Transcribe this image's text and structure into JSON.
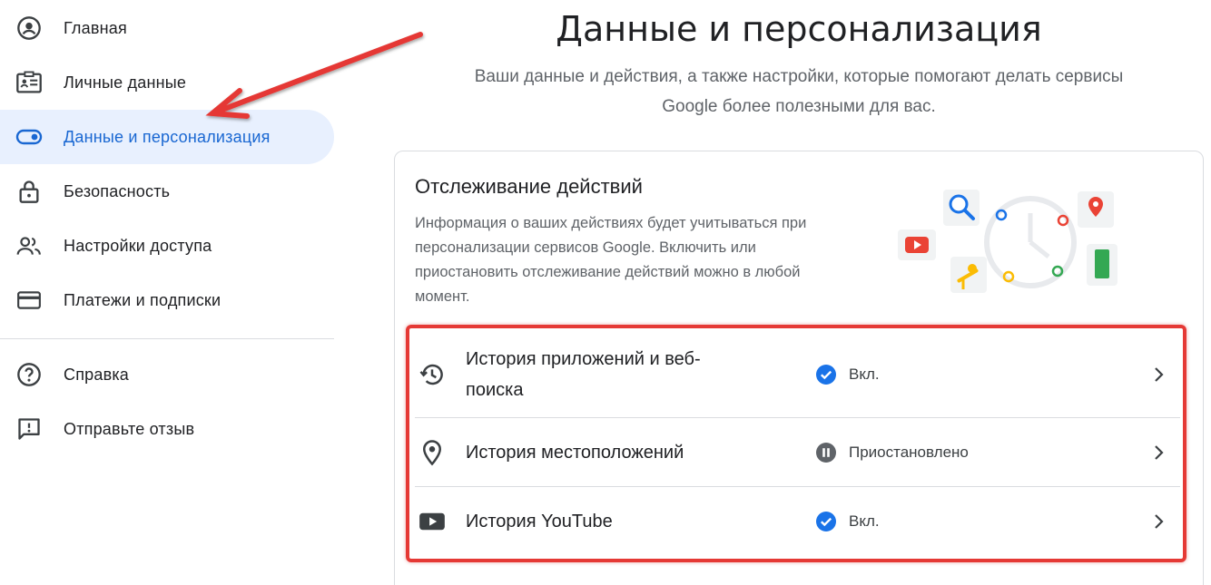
{
  "sidebar": {
    "items": [
      {
        "label": "Главная",
        "icon": "account-circle-icon"
      },
      {
        "label": "Личные данные",
        "icon": "id-card-icon"
      },
      {
        "label": "Данные и персонализация",
        "icon": "toggle-icon",
        "active": true
      },
      {
        "label": "Безопасность",
        "icon": "lock-icon"
      },
      {
        "label": "Настройки доступа",
        "icon": "people-icon"
      },
      {
        "label": "Платежи и подписки",
        "icon": "credit-card-icon"
      },
      {
        "label": "Справка",
        "icon": "help-icon"
      },
      {
        "label": "Отправьте отзыв",
        "icon": "feedback-icon"
      }
    ]
  },
  "header": {
    "title": "Данные и персонализация",
    "subtitle_line1": "Ваши данные и действия, а также настройки, которые помогают делать сервисы",
    "subtitle_line2": "Google более полезными для вас."
  },
  "activity_card": {
    "title": "Отслеживание действий",
    "description": "Информация о ваших действиях будет учитываться при персонализации сервисов Google. Включить или приостановить отслеживание действий можно в любой момент.",
    "rows": [
      {
        "label": "История приложений и веб-поиска",
        "status": "Вкл.",
        "status_icon": "check-circle-icon",
        "icon": "history-icon"
      },
      {
        "label": "История местоположений",
        "status": "Приостановлено",
        "status_icon": "pause-circle-icon",
        "icon": "location-pin-icon"
      },
      {
        "label": "История YouTube",
        "status": "Вкл.",
        "status_icon": "check-circle-icon",
        "icon": "youtube-icon"
      }
    ]
  },
  "colors": {
    "accent_blue": "#1a73e8",
    "active_nav_bg": "#e8f0fe",
    "annotation_red": "#e53935",
    "pause_gray": "#5f6368"
  }
}
